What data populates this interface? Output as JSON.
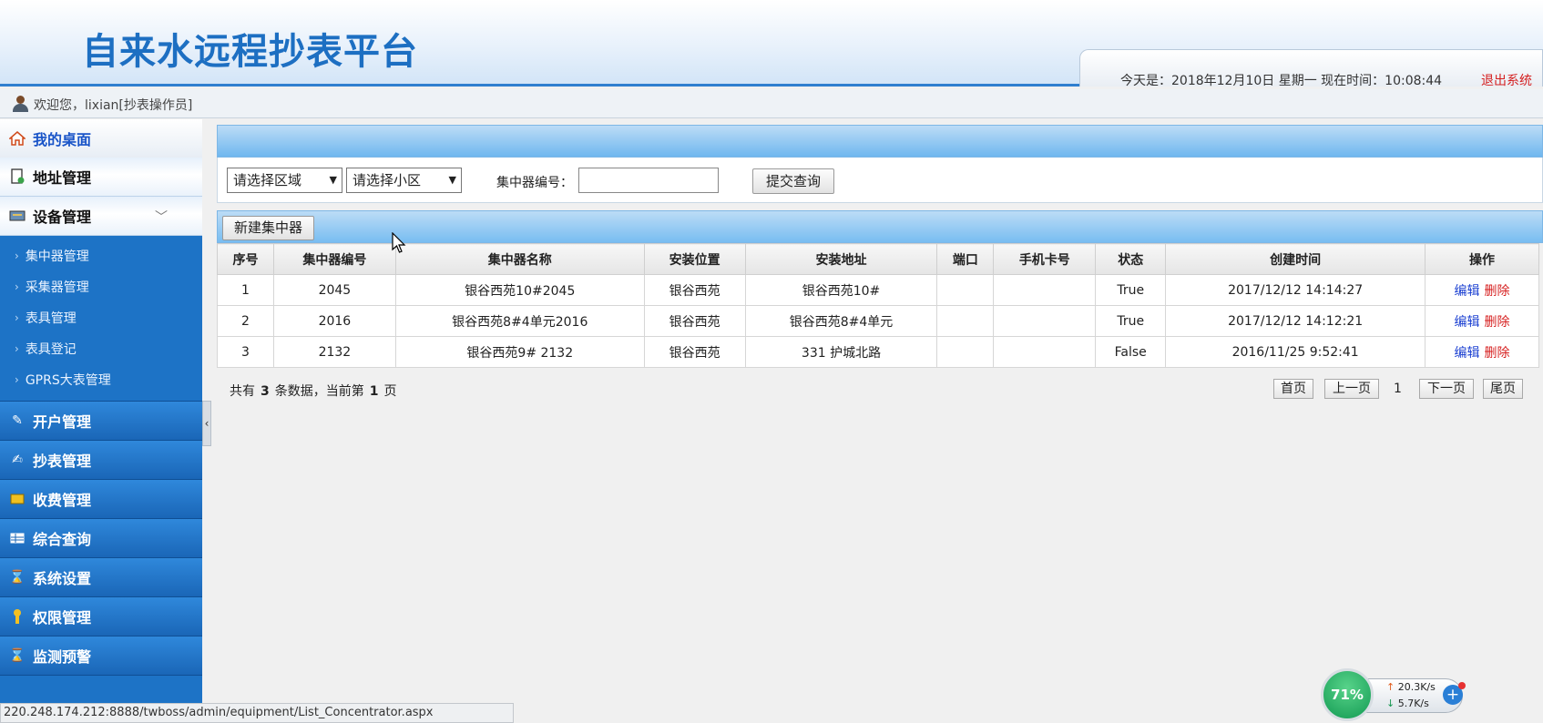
{
  "header": {
    "title": "自来水远程抄表平台",
    "datetime_info": "今天是：2018年12月10日 星期一 现在时间：10:08:44",
    "logout": "退出系统"
  },
  "welcome": {
    "text": "欢迎您，lixian[抄表操作员]"
  },
  "sidebar": {
    "desktop": "我的桌面",
    "items": [
      {
        "label": "地址管理",
        "icon": "address-doc-icon"
      },
      {
        "label": "设备管理",
        "icon": "device-icon"
      }
    ],
    "sub_items": [
      "集中器管理",
      "采集器管理",
      "表具管理",
      "表具登记",
      "GPRS大表管理"
    ],
    "bottom_items": [
      {
        "label": "开户管理",
        "icon": "account-open-icon"
      },
      {
        "label": "抄表管理",
        "icon": "meter-read-icon"
      },
      {
        "label": "收费管理",
        "icon": "fee-icon"
      },
      {
        "label": "综合查询",
        "icon": "query-icon"
      },
      {
        "label": "系统设置",
        "icon": "hourglass-icon"
      },
      {
        "label": "权限管理",
        "icon": "permission-icon"
      },
      {
        "label": "监测预警",
        "icon": "hourglass-icon"
      }
    ]
  },
  "filters": {
    "region_select": "请选择区域",
    "community_select": "请选择小区",
    "concentrator_label": "集中器编号：",
    "concentrator_value": "",
    "submit_label": "提交查询"
  },
  "toolbar": {
    "new_label": "新建集中器"
  },
  "table": {
    "columns": [
      "序号",
      "集中器编号",
      "集中器名称",
      "安装位置",
      "安装地址",
      "端口",
      "手机卡号",
      "状态",
      "创建时间",
      "操作"
    ],
    "rows": [
      [
        "1",
        "2045",
        "银谷西苑10#2045",
        "银谷西苑",
        "银谷西苑10#",
        "",
        "",
        "True",
        "2017/12/12 14:14:27"
      ],
      [
        "2",
        "2016",
        "银谷西苑8#4单元2016",
        "银谷西苑",
        "银谷西苑8#4单元",
        "",
        "",
        "True",
        "2017/12/12 14:12:21"
      ],
      [
        "3",
        "2132",
        "银谷西苑9# 2132",
        "银谷西苑",
        "331 护城北路",
        "",
        "",
        "False",
        "2016/11/25 9:52:41"
      ]
    ],
    "edit_label": "编辑",
    "delete_label": "删除"
  },
  "pager": {
    "prefix": "共有",
    "total": "3",
    "middle": "条数据，当前第",
    "current": "1",
    "suffix": "页",
    "first": "首页",
    "prev": "上一页",
    "page_num": "1",
    "next": "下一页",
    "last": "尾页"
  },
  "status_url": "220.248.174.212:8888/twboss/admin/equipment/List_Concentrator.aspx",
  "speed_widget": {
    "percent": "71%",
    "up": "20.3K/s",
    "down": "5.7K/s"
  },
  "colors": {
    "brand_blue": "#1d6fc2",
    "sidebar_blue": "#1d73c6",
    "logout_red": "#d52020",
    "edit_blue": "#1a3fd1",
    "delete_red": "#d61f1f"
  }
}
